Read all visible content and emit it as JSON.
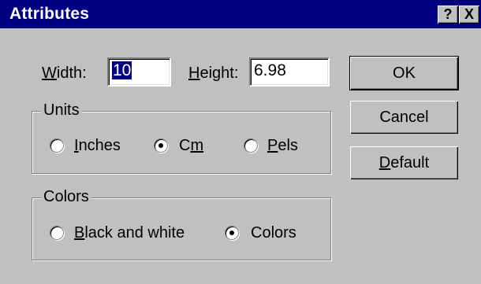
{
  "window": {
    "title": "Attributes",
    "help_label": "?",
    "close_label": "X"
  },
  "size": {
    "width_label_prefix": "",
    "width_label_mnemonic": "W",
    "width_label_rest": "idth:",
    "width_value": "10",
    "height_label_mnemonic": "H",
    "height_label_rest": "eight:",
    "height_value": "6.98"
  },
  "units": {
    "group_label": "Units",
    "options": [
      {
        "mnemonic": "I",
        "rest": "nches",
        "selected": false
      },
      {
        "pre": "C",
        "mnemonic": "m",
        "rest": "",
        "selected": true
      },
      {
        "mnemonic": "P",
        "rest": "els",
        "selected": false
      }
    ]
  },
  "colors": {
    "group_label": "Colors",
    "options": [
      {
        "mnemonic": "B",
        "rest": "lack and white",
        "selected": false
      },
      {
        "pre": "Colors",
        "selected": true
      }
    ]
  },
  "buttons": {
    "ok": "OK",
    "cancel": "Cancel",
    "default_mnemonic": "D",
    "default_rest": "efault"
  },
  "theme": {
    "face": "#c0c0c0",
    "titlebar": "#000080",
    "selection": "#000080"
  }
}
